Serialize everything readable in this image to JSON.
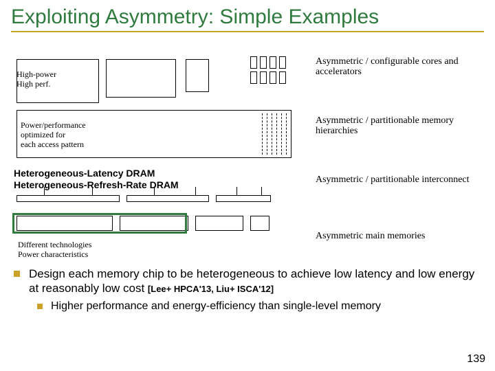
{
  "title": "Exploiting Asymmetry: Simple Examples",
  "core_labels": {
    "high_power": "High-power",
    "high_perf": "High perf."
  },
  "right_labels": {
    "cores": "Asymmetric / configurable cores and accelerators",
    "memhier": "Asymmetric / partitionable memory hierarchies",
    "interconnect": "Asymmetric / partitionable interconnect",
    "mainmem": "Asymmetric main memories"
  },
  "mem_labels": {
    "l1": "Power/performance",
    "l2": "optimized for",
    "l3": "each access pattern"
  },
  "annotation": {
    "line1": "Heterogeneous-Latency DRAM",
    "line2": "Heterogeneous-Refresh-Rate DRAM"
  },
  "mainmem_labels": {
    "l1": "Different technologies",
    "l2": "Power characteristics"
  },
  "bullet1_pre": "Design each memory chip to be heterogeneous to achieve low latency and low energy at reasonably low cost ",
  "bullet1_cite": "[Lee+ HPCA'13, Liu+ ISCA'12]",
  "bullet2": "Higher performance and energy-efficiency than single-level memory",
  "page_number": "139"
}
